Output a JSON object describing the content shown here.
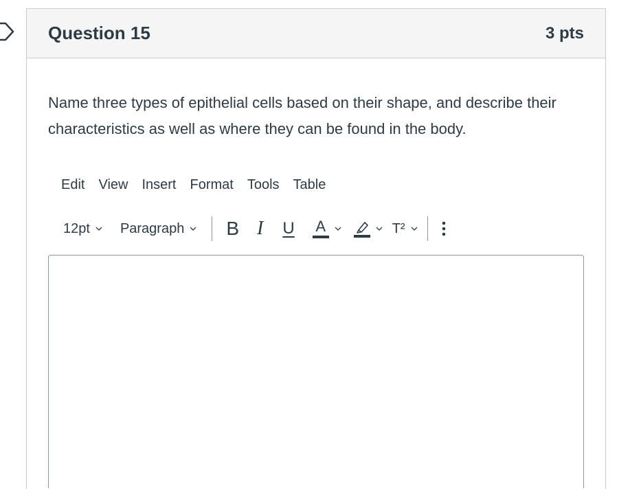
{
  "question": {
    "title": "Question 15",
    "points": "3 pts",
    "text": "Name three types of epithelial cells based on their shape, and describe their characteristics as well as where they can be found in the body."
  },
  "menubar": {
    "items": [
      "Edit",
      "View",
      "Insert",
      "Format",
      "Tools",
      "Table"
    ]
  },
  "toolbar": {
    "font_size": "12pt",
    "block_format": "Paragraph",
    "bold_label": "B",
    "italic_label": "I",
    "underline_label": "U",
    "text_color_label": "A",
    "superscript_label": "T²",
    "more_label": "⋮",
    "colors": {
      "text_color_bar": "#2d3b45",
      "highlight_bar": "#2d3b45"
    }
  },
  "editor": {
    "value": ""
  },
  "colors": {
    "header_bg": "#f5f5f5",
    "border": "#c7cdd1",
    "text": "#2d3b45"
  }
}
